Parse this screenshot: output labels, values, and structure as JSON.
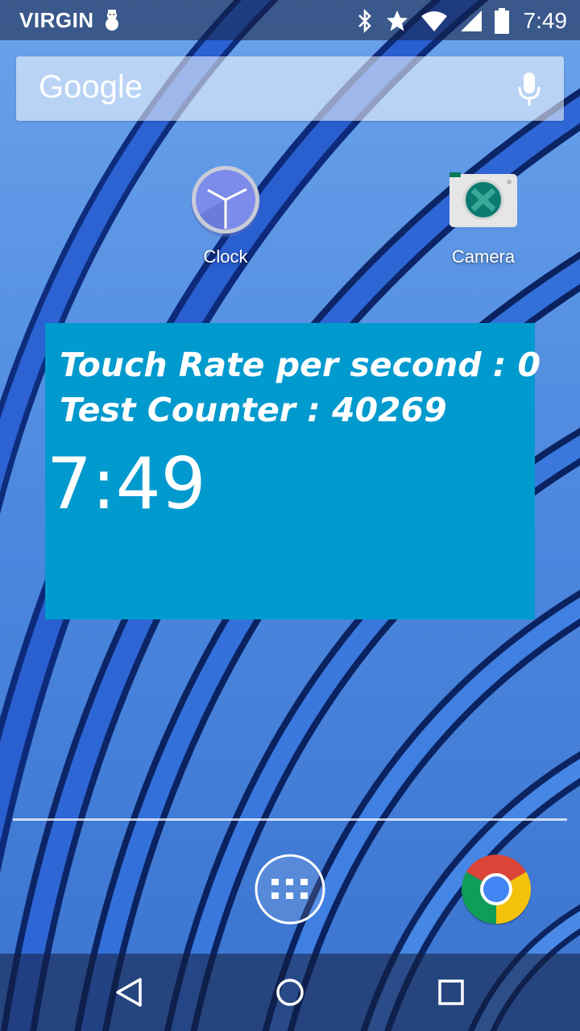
{
  "status_bar": {
    "carrier": "VIRGIN",
    "time": "7:49",
    "icons": [
      "snowman-icon",
      "bluetooth-icon",
      "star-icon",
      "wifi-icon",
      "signal-icon",
      "battery-icon"
    ]
  },
  "search": {
    "logo_text": "Google",
    "icon": "mic-icon"
  },
  "apps": [
    {
      "label": "Clock",
      "icon": "clock-app-icon"
    },
    {
      "label": "Camera",
      "icon": "camera-app-icon"
    }
  ],
  "widget": {
    "touch_rate": "Touch Rate per second : 0",
    "test_counter": "Test Counter : 40269",
    "time": "7:49",
    "background_color": "#009ace"
  },
  "dock": {
    "items": [
      "app-drawer-icon",
      "chrome-icon"
    ]
  },
  "nav_bar": {
    "buttons": [
      "back-icon",
      "home-icon",
      "recents-icon"
    ]
  },
  "colors": {
    "wallpaper": "#4f8ae0",
    "widget": "#009ace",
    "text": "#ffffff"
  }
}
